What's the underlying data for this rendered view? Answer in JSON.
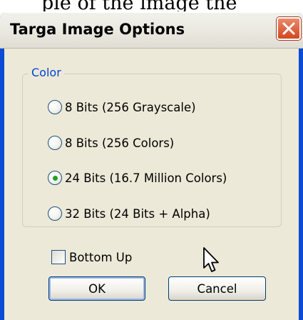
{
  "caption": "ple of the image the",
  "window": {
    "title": "Targa Image Options",
    "close_icon": "close-icon"
  },
  "color_group": {
    "label": "Color",
    "options": [
      {
        "label": "8 Bits (256 Grayscale)",
        "selected": false
      },
      {
        "label": "8 Bits (256 Colors)",
        "selected": false
      },
      {
        "label": "24 Bits (16.7 Million Colors)",
        "selected": true
      },
      {
        "label": "32 Bits (24 Bits + Alpha)",
        "selected": false
      }
    ]
  },
  "bottom_up": {
    "label": "Bottom Up",
    "checked": false
  },
  "buttons": {
    "ok": "OK",
    "cancel": "Cancel"
  },
  "colors": {
    "titlebar_bg": "#eae8df",
    "frame": "#0b4bd5",
    "client_bg": "#ece9d8",
    "group_label": "#0046d5",
    "close_red": "#d4461f",
    "radio_dot": "#21a121"
  }
}
